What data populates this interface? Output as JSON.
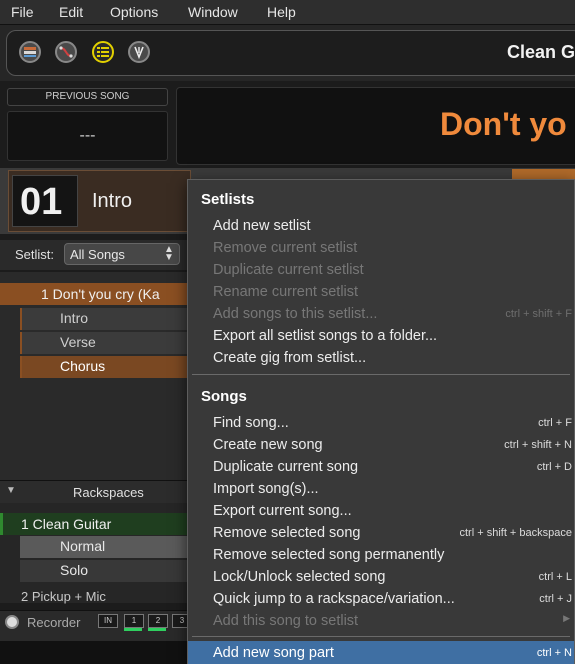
{
  "menubar": {
    "items": [
      "File",
      "Edit",
      "Options",
      "Window",
      "Help"
    ]
  },
  "toolbar": {
    "icons": [
      "rackspace-view-icon",
      "wiring-view-icon",
      "setlist-view-icon",
      "tuner-icon"
    ],
    "rackspace_title": "Clean G"
  },
  "previous_song": {
    "label": "PREVIOUS SONG",
    "value": "---"
  },
  "current_song": {
    "title": "Don't yo"
  },
  "part": {
    "number": "01",
    "name": "Intro"
  },
  "setlist": {
    "label": "Setlist:",
    "value": "All Songs"
  },
  "songs": {
    "current": "1 Don't you cry (Ka",
    "parts": [
      "Intro",
      "Verse",
      "Chorus"
    ]
  },
  "rackspaces": {
    "header": "Rackspaces",
    "items": [
      {
        "label": "1 Clean Guitar",
        "variations": [
          "Normal",
          "Solo"
        ]
      },
      {
        "label": "2 Pickup + Mic"
      }
    ]
  },
  "recorder": {
    "label": "Recorder",
    "channels": [
      "IN",
      "1",
      "2",
      "3"
    ]
  },
  "colors": {
    "accent_orange": "#f08a3c",
    "song_row": "#8a4f22",
    "rack_active": "#2f8a2f",
    "menu_highlight": "#3f6fa3"
  },
  "menu": {
    "setlists_header": "Setlists",
    "setlist_items": [
      {
        "label": "Add new setlist",
        "shortcut": "",
        "enabled": true
      },
      {
        "label": "Remove current setlist",
        "shortcut": "",
        "enabled": false
      },
      {
        "label": "Duplicate current setlist",
        "shortcut": "",
        "enabled": false
      },
      {
        "label": "Rename current setlist",
        "shortcut": "",
        "enabled": false
      },
      {
        "label": "Add songs to this setlist...",
        "shortcut": "ctrl + shift + F",
        "enabled": false
      },
      {
        "label": "Export all setlist songs to a folder...",
        "shortcut": "",
        "enabled": true
      },
      {
        "label": "Create gig from setlist...",
        "shortcut": "",
        "enabled": true
      }
    ],
    "songs_header": "Songs",
    "song_items": [
      {
        "label": "Find song...",
        "shortcut": "ctrl + F",
        "enabled": true
      },
      {
        "label": "Create new song",
        "shortcut": "ctrl + shift + N",
        "enabled": true
      },
      {
        "label": "Duplicate current song",
        "shortcut": "ctrl + D",
        "enabled": true
      },
      {
        "label": "Import song(s)...",
        "shortcut": "",
        "enabled": true
      },
      {
        "label": "Export current song...",
        "shortcut": "",
        "enabled": true
      },
      {
        "label": "Remove selected song",
        "shortcut": "ctrl + shift + backspace",
        "enabled": true
      },
      {
        "label": "Remove selected song permanently",
        "shortcut": "",
        "enabled": true
      },
      {
        "label": "Lock/Unlock selected song",
        "shortcut": "ctrl + L",
        "enabled": true
      },
      {
        "label": "Quick jump to a rackspace/variation...",
        "shortcut": "ctrl + J",
        "enabled": true
      },
      {
        "label": "Add this song to setlist",
        "shortcut": "",
        "enabled": false
      }
    ],
    "highlighted_item": {
      "label": "Add new song part",
      "shortcut": "ctrl + N"
    }
  }
}
